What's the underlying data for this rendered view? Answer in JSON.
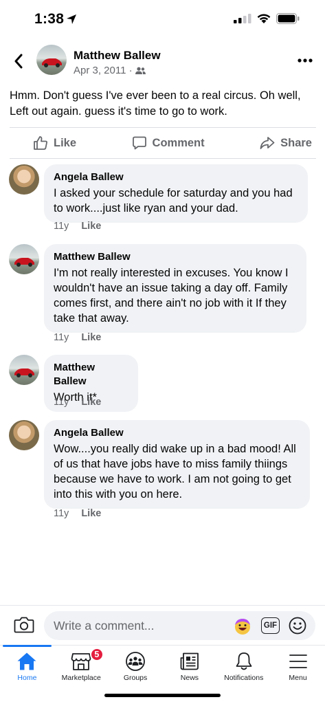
{
  "status_bar": {
    "time": "1:38"
  },
  "post": {
    "author": "Matthew Ballew",
    "date": "Apr 3, 2011 ·",
    "text": "Hmm. Don't guess I've ever been to a real circus. Oh well, Left out again. guess it's time to go to work."
  },
  "actions": {
    "like": "Like",
    "comment": "Comment",
    "share": "Share"
  },
  "comments": [
    {
      "name": "Angela Ballew",
      "text": "I asked your schedule for saturday and you had to work....just like ryan and your dad.",
      "age": "11y",
      "like": "Like"
    },
    {
      "name": "Matthew Ballew",
      "text": "I'm not really interested in excuses. You know I wouldn't have an issue taking a day off. Family comes first, and there ain't no job with it If they take that away.",
      "age": "11y",
      "like": "Like"
    },
    {
      "name": "Matthew Ballew",
      "text": "Worth it*",
      "age": "11y",
      "like": "Like"
    },
    {
      "name": "Angela Ballew",
      "text": "Wow....you really did wake up in a bad mood! All of us that have jobs have to miss family thiings because we have to work. I am not going to get into this with you on here.",
      "age": "11y",
      "like": "Like"
    }
  ],
  "composer": {
    "placeholder": "Write a comment...",
    "gif": "GIF"
  },
  "tabs": [
    {
      "label": "Home"
    },
    {
      "label": "Marketplace",
      "badge": "5"
    },
    {
      "label": "Groups"
    },
    {
      "label": "News"
    },
    {
      "label": "Notifications"
    },
    {
      "label": "Menu"
    }
  ],
  "colors": {
    "accent": "#1877f2",
    "bubble": "#f0f2f5",
    "secondary_text": "#65676b",
    "badge": "#e41e3f"
  }
}
